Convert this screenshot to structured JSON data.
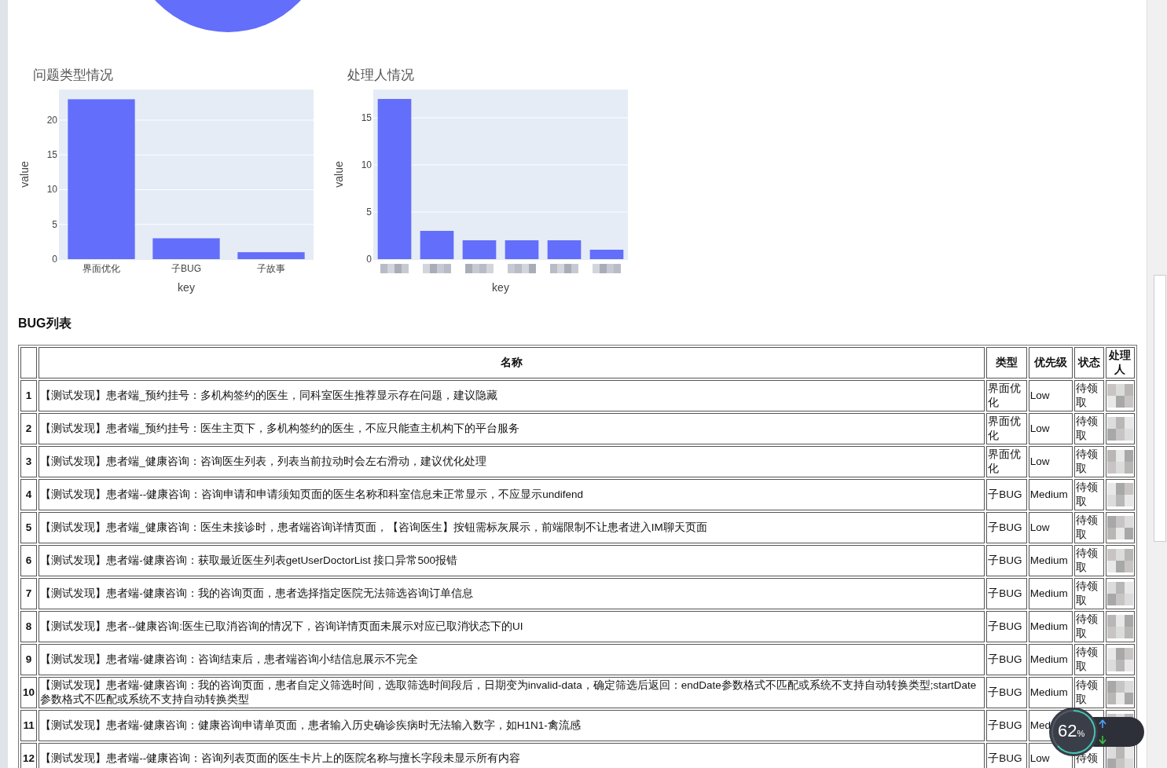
{
  "charts": [
    {
      "chart_data": {
        "type": "bar",
        "title": "问题类型情况",
        "xlabel": "key",
        "ylabel": "value",
        "categories": [
          "界面优化",
          "子BUG",
          "子故事"
        ],
        "values": [
          23,
          3,
          1
        ],
        "grid": true,
        "yticks": [
          0,
          5,
          10,
          15,
          20
        ],
        "ylim": [
          0,
          24.4
        ]
      }
    },
    {
      "chart_data": {
        "type": "bar",
        "title": "处理人情况",
        "xlabel": "key",
        "ylabel": "value",
        "values": [
          17,
          3,
          2,
          2,
          2,
          1
        ],
        "grid": true,
        "yticks": [
          0,
          5,
          10,
          15
        ],
        "ylim": [
          0,
          18
        ]
      }
    }
  ],
  "table": {
    "title": "BUG列表",
    "columns": [
      "名称",
      "类型",
      "优先级",
      "状态",
      "处理人"
    ],
    "rows": [
      {
        "index": "1",
        "name": "【测试发现】患者端_预约挂号：多机构签约的医生，同科室医生推荐显示存在问题，建议隐藏",
        "type": "界面优化",
        "priority": "Low",
        "status": "待领取"
      },
      {
        "index": "2",
        "name": "【测试发现】患者端_预约挂号：医生主页下，多机构签约的医生，不应只能查主机构下的平台服务",
        "type": "界面优化",
        "priority": "Low",
        "status": "待领取"
      },
      {
        "index": "3",
        "name": "【测试发现】患者端_健康咨询：咨询医生列表，列表当前拉动时会左右滑动，建议优化处理",
        "type": "界面优化",
        "priority": "Low",
        "status": "待领取"
      },
      {
        "index": "4",
        "name": "【测试发现】患者端--健康咨询：咨询申请和申请须知页面的医生名称和科室信息未正常显示，不应显示undifend",
        "type": "子BUG",
        "priority": "Medium",
        "status": "待领取"
      },
      {
        "index": "5",
        "name": "【测试发现】患者端_健康咨询：医生未接诊时，患者端咨询详情页面，【咨询医生】按钮需标灰展示，前端限制不让患者进入IM聊天页面",
        "type": "子BUG",
        "priority": "Low",
        "status": "待领取"
      },
      {
        "index": "6",
        "name": "【测试发现】患者端-健康咨询：获取最近医生列表getUserDoctorList 接口异常500报错",
        "type": "子BUG",
        "priority": "Medium",
        "status": "待领取"
      },
      {
        "index": "7",
        "name": "【测试发现】患者端-健康咨询：我的咨询页面，患者选择指定医院无法筛选咨询订单信息",
        "type": "子BUG",
        "priority": "Medium",
        "status": "待领取"
      },
      {
        "index": "8",
        "name": "【测试发现】患者--健康咨询:医生已取消咨询的情况下，咨询详情页面未展示对应已取消状态下的UI",
        "type": "子BUG",
        "priority": "Medium",
        "status": "待领取"
      },
      {
        "index": "9",
        "name": "【测试发现】患者端-健康咨询：咨询结束后，患者端咨询小结信息展示不完全",
        "type": "子BUG",
        "priority": "Medium",
        "status": "待领取"
      },
      {
        "index": "10",
        "name": "【测试发现】患者端-健康咨询：我的咨询页面，患者自定义筛选时间，选取筛选时间段后，日期变为invalid-data，确定筛选后返回：endDate参数格式不匹配或系统不支持自动转换类型;startDate参数格式不匹配或系统不支持自动转换类型",
        "type": "子BUG",
        "priority": "Medium",
        "status": "待领取"
      },
      {
        "index": "11",
        "name": "【测试发现】患者端-健康咨询：健康咨询申请单页面，患者输入历史确诊疾病时无法输入数字，如H1N1-禽流感",
        "type": "子BUG",
        "priority": "Med"
      },
      {
        "index": "12",
        "name": "【测试发现】患者端--健康咨询：咨询列表页面的医生卡片上的医院名称与擅长字段未显示所有内容",
        "type": "子BUG",
        "priority": "Low",
        "status": "待领"
      }
    ]
  },
  "meter": {
    "text": "62",
    "unit": "%"
  }
}
